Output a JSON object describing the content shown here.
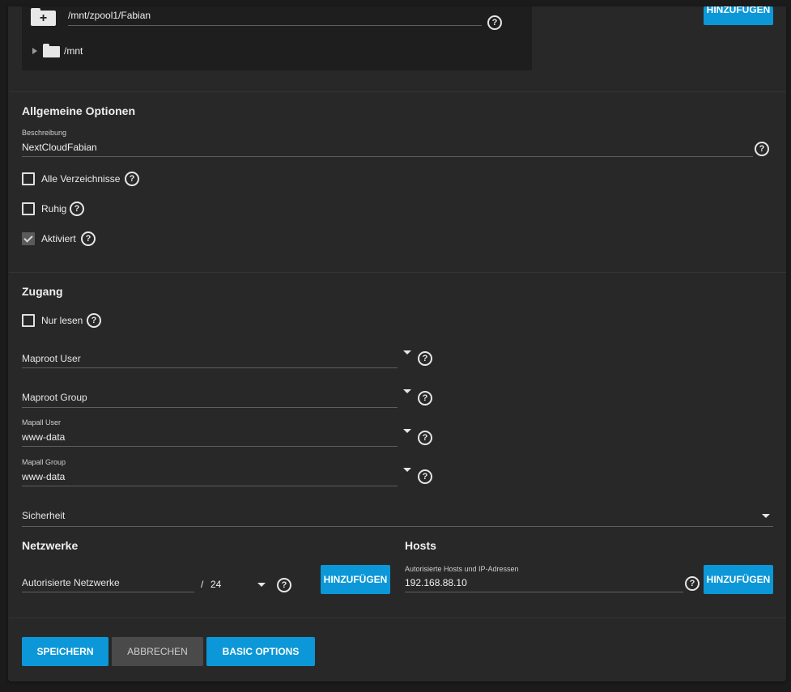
{
  "tree": {
    "path_value": "/mnt/zpool1/Fabian",
    "root_node": "/mnt",
    "add_button": "HINZUFÜGEN"
  },
  "general": {
    "title": "Allgemeine Optionen",
    "description_label": "Beschreibung",
    "description_value": "NextCloudFabian",
    "all_dirs_label": "Alle Verzeichnisse",
    "quiet_label": "Ruhig",
    "enabled_label": "Aktiviert",
    "all_dirs_checked": false,
    "quiet_checked": false,
    "enabled_checked": true
  },
  "access": {
    "title": "Zugang",
    "readonly_label": "Nur lesen",
    "readonly_checked": false,
    "maproot_user_placeholder": "Maproot User",
    "maproot_group_placeholder": "Maproot Group",
    "mapall_user_label": "Mapall User",
    "mapall_user_value": "www-data",
    "mapall_group_label": "Mapall Group",
    "mapall_group_value": "www-data",
    "security_placeholder": "Sicherheit"
  },
  "networks": {
    "title": "Netzwerke",
    "placeholder": "Autorisierte Netzwerke",
    "slash": "/",
    "mask": "24",
    "add_button": "HINZUFÜGEN"
  },
  "hosts": {
    "title": "Hosts",
    "label": "Autorisierte Hosts und IP-Adressen",
    "value": "192.168.88.10",
    "add_button": "HINZUFÜGEN"
  },
  "actions": {
    "save": "SPEICHERN",
    "cancel": "ABBRECHEN",
    "basic": "BASIC OPTIONS"
  },
  "help_glyph": "?",
  "colors": {
    "accent": "#0c97d8",
    "panel": "#282828",
    "background": "#1b1b1b"
  }
}
